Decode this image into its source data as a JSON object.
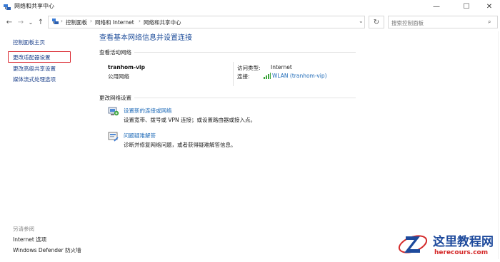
{
  "window": {
    "title": "网络和共享中心",
    "controls": {
      "minimize": "—",
      "maximize": "☐",
      "close": "✕"
    }
  },
  "nav": {
    "back": "←",
    "forward": "→",
    "dropdown": "⌄",
    "up": "↑"
  },
  "address": {
    "breadcrumbs": [
      "控制面板",
      "网络和 Internet",
      "网络和共享中心"
    ],
    "separator": "›",
    "dropdown": "⌄",
    "refresh": "↻"
  },
  "search": {
    "placeholder": "搜索控制面板",
    "icon": "⌕"
  },
  "sidebar": {
    "items": [
      {
        "label": "控制面板主页"
      },
      {
        "label": "更改适配器设置"
      },
      {
        "label": "更改高级共享设置"
      },
      {
        "label": "媒体流式处理选项"
      }
    ],
    "see_also_label": "另请参阅",
    "see_also": [
      {
        "label": "Internet 选项"
      },
      {
        "label": "Windows Defender 防火墙"
      }
    ]
  },
  "main": {
    "heading": "查看基本网络信息并设置连接",
    "active_networks_label": "查看活动网络",
    "network": {
      "name": "tranhom-vip",
      "type": "公用网络",
      "access_type_label": "访问类型:",
      "access_type_value": "Internet",
      "connections_label": "连接:",
      "connection_value": "WLAN (tranhom-vip)"
    },
    "change_settings_label": "更改网络设置",
    "tasks": [
      {
        "link": "设置新的连接或网络",
        "desc": "设置宽带、拨号或 VPN 连接；或设置路由器或接入点。"
      },
      {
        "link": "问题疑难解答",
        "desc": "诊断并修复网络问题，或者获得疑难解答信息。"
      }
    ]
  },
  "watermark": {
    "title": "这里教程网",
    "url": "herecours.com"
  },
  "colors": {
    "link": "#1f6bb8",
    "heading": "#1f4e9b",
    "highlight": "#d9262e"
  }
}
